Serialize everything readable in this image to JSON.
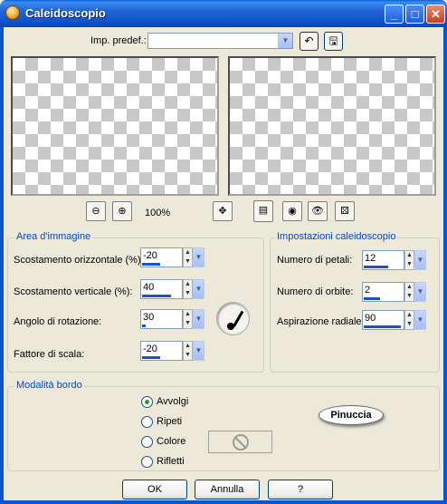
{
  "window": {
    "title": "Caleidoscopio"
  },
  "preset": {
    "label": "Imp. predef.:",
    "value": ""
  },
  "preview": {
    "zoom": "100%"
  },
  "area": {
    "title": "Area d'immagine",
    "fields": [
      {
        "label": "Scostamento orizzontale (%):",
        "value": "-20",
        "fill": 0.45
      },
      {
        "label": "Scostamento verticale (%):",
        "value": "40",
        "fill": 0.7
      },
      {
        "label": "Angolo di rotazione:",
        "value": "30",
        "fill": 0.08
      },
      {
        "label": "Fattore di scala:",
        "value": "-20",
        "fill": 0.45
      }
    ]
  },
  "settings": {
    "title": "Impostazioni caleidoscopio",
    "fields": [
      {
        "label": "Numero di petali:",
        "value": "12",
        "fill": 0.6
      },
      {
        "label": "Numero di orbite:",
        "value": "2",
        "fill": 0.4
      },
      {
        "label": "Aspirazione radiale:",
        "value": "90",
        "fill": 0.9
      }
    ]
  },
  "border_mode": {
    "title": "Modalità bordo",
    "options": [
      "Avvolgi",
      "Ripeti",
      "Colore",
      "Rifletti"
    ],
    "selected": "Avvolgi"
  },
  "logo": "Pinuccia",
  "buttons": {
    "ok": "OK",
    "cancel": "Annulla",
    "help": "?"
  }
}
